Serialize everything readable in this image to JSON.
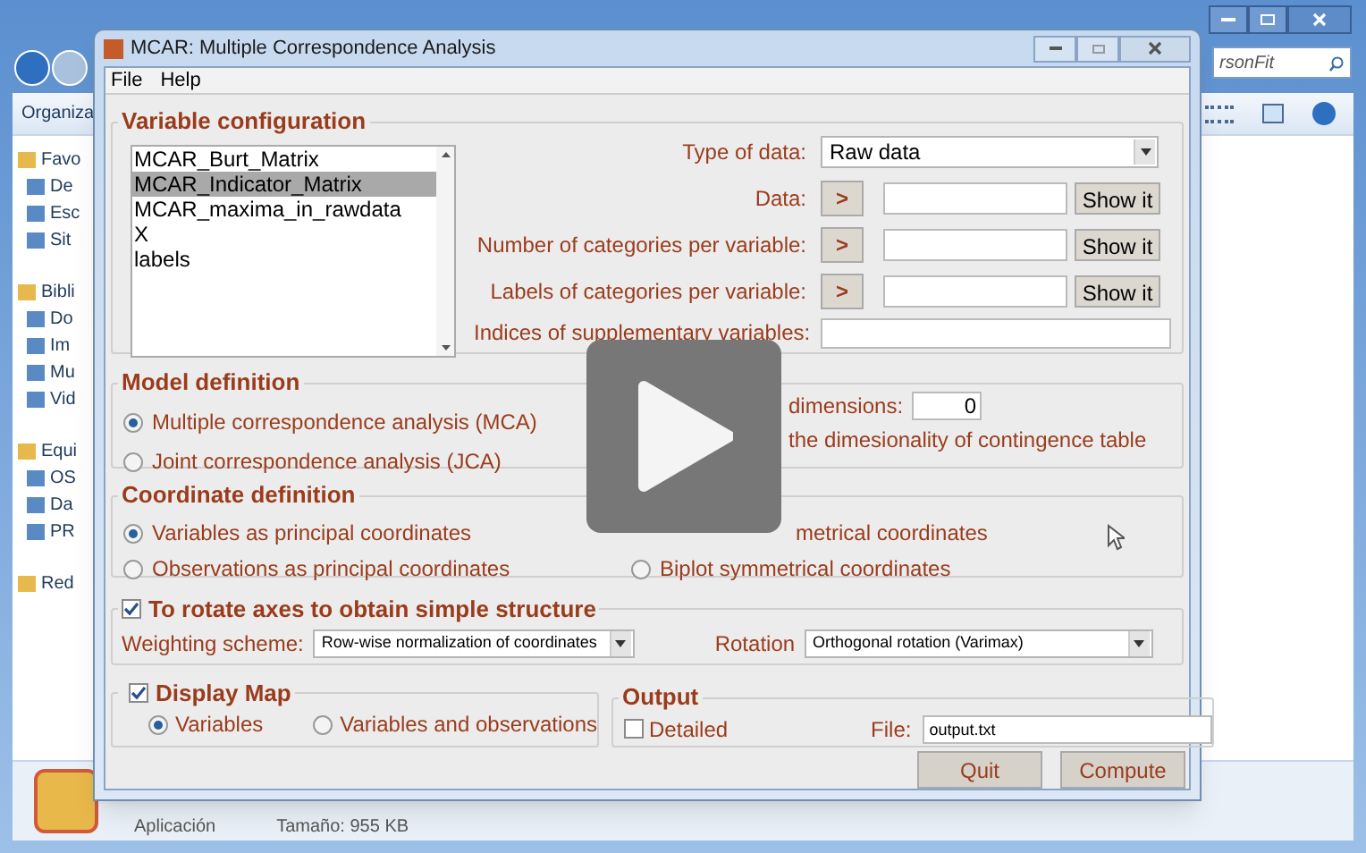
{
  "explorer": {
    "toolbar_label": "Organiza",
    "search_text": "rsonFit",
    "nav": [
      {
        "label": "Favo",
        "children": [
          {
            "label": "De"
          },
          {
            "label": "Esc"
          },
          {
            "label": "Sit"
          }
        ]
      },
      {
        "label": "Bibli",
        "children": [
          {
            "label": "Do"
          },
          {
            "label": "Im"
          },
          {
            "label": "Mu"
          },
          {
            "label": "Vid"
          }
        ]
      },
      {
        "label": "Equi",
        "children": [
          {
            "label": "OS"
          },
          {
            "label": "Da"
          },
          {
            "label": "PR"
          }
        ]
      },
      {
        "label": "Red"
      }
    ],
    "details": {
      "type": "Aplicación",
      "size": "Tamaño: 955 KB"
    }
  },
  "window": {
    "title": "MCAR: Multiple Correspondence Analysis",
    "menu": [
      "File",
      "Help"
    ]
  },
  "variable_configuration": {
    "title": "Variable configuration",
    "variables": [
      {
        "label": "MCAR_Burt_Matrix",
        "selected": false
      },
      {
        "label": "MCAR_Indicator_Matrix",
        "selected": true
      },
      {
        "label": "MCAR_maxima_in_rawdata",
        "selected": false
      },
      {
        "label": "X",
        "selected": false
      },
      {
        "label": "labels",
        "selected": false
      }
    ],
    "type_of_data": {
      "label": "Type of data:",
      "value": "Raw data"
    },
    "inputs": [
      {
        "label": "Data:",
        "button": ">",
        "show": "Show it"
      },
      {
        "label": "Number of categories per variable:",
        "button": ">",
        "show": "Show it"
      },
      {
        "label": "Labels of categories per variable:",
        "button": ">",
        "show": "Show it"
      }
    ],
    "supplementary_label": "Indices of supplementary variables:"
  },
  "model_definition": {
    "title": "Model definition",
    "options": [
      {
        "label": "Multiple correspondence analysis (MCA)",
        "selected": true
      },
      {
        "label": "Joint correspondence analysis (JCA)",
        "selected": false
      }
    ],
    "dimensions_label": "dimensions:",
    "dimensions_value": "0",
    "note": "the dimesionality of contingence table"
  },
  "coordinate_definition": {
    "title": "Coordinate definition",
    "options": [
      {
        "label": "Variables as principal coordinates",
        "selected": true
      },
      {
        "label": "Observations as principal coordinates",
        "selected": false
      },
      {
        "label": "Biplot symmetrical coordinates",
        "selected": false
      }
    ],
    "partial_text": "metrical coordinates"
  },
  "rotation": {
    "title": "To rotate axes to obtain simple structure",
    "checked": true,
    "weighting_label": "Weighting scheme:",
    "weighting_value": "Row-wise normalization of coordinates",
    "rotation_label": "Rotation",
    "rotation_value": "Orthogonal rotation (Varimax)"
  },
  "display_map": {
    "title": "Display Map",
    "checked": true,
    "options": [
      {
        "label": "Variables",
        "selected": true
      },
      {
        "label": "Variables and observations",
        "selected": false
      }
    ]
  },
  "output": {
    "title": "Output",
    "detailed_label": "Detailed",
    "detailed_checked": false,
    "file_label": "File:",
    "file_value": "output.txt"
  },
  "buttons": [
    "Quit",
    "Compute"
  ]
}
